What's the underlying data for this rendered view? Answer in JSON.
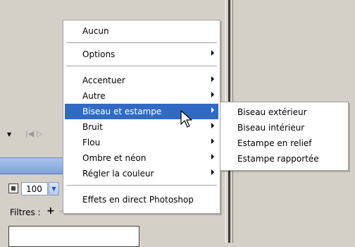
{
  "app": {
    "zoom_value": "100",
    "filters_label": "Filtres :",
    "add_filter_glyph": "+",
    "remove_filter_glyph": "−",
    "first_glyph": "|◀",
    "prev_glyph": "▷",
    "dropdown_glyph": "▼"
  },
  "menu": {
    "items": [
      {
        "label": "Aucun"
      },
      {
        "label": "Options"
      },
      {
        "label": "Accentuer"
      },
      {
        "label": "Autre"
      },
      {
        "label": "Biseau et estampe",
        "highlighted": true
      },
      {
        "label": "Bruit"
      },
      {
        "label": "Flou"
      },
      {
        "label": "Ombre et néon"
      },
      {
        "label": "Régler la couleur"
      },
      {
        "label": "Effets en direct Photoshop"
      }
    ]
  },
  "submenu": {
    "items": [
      {
        "label": "Biseau extérieur"
      },
      {
        "label": "Biseau intérieur"
      },
      {
        "label": "Estampe en relief"
      },
      {
        "label": "Estampe rapportée"
      }
    ]
  },
  "colors": {
    "highlight": "#316ac5",
    "menu_bg": "#ffffff",
    "window_bg": "#d4d0c8"
  }
}
